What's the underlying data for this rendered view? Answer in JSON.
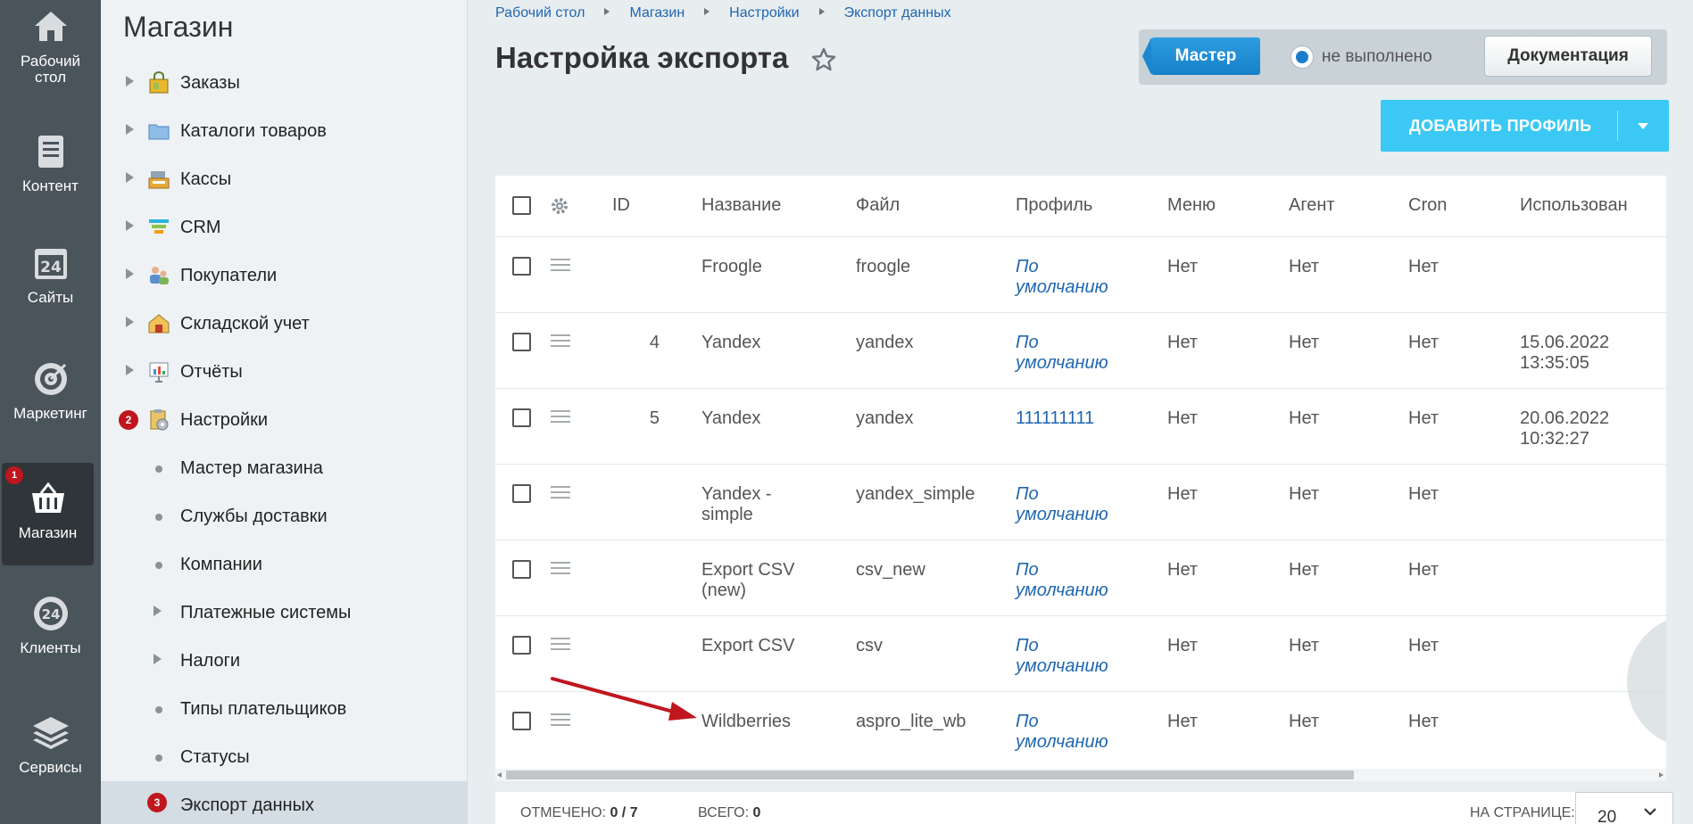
{
  "leftbar": {
    "items": [
      {
        "label": "Рабочий стол",
        "icon": "home-icon"
      },
      {
        "label": "Контент",
        "icon": "document-icon"
      },
      {
        "label": "Сайты",
        "icon": "calendar-24-icon"
      },
      {
        "label": "Маркетинг",
        "icon": "target-icon"
      },
      {
        "label": "Магазин",
        "icon": "basket-icon",
        "badge": "1"
      },
      {
        "label": "Клиенты",
        "icon": "clients-24-icon"
      },
      {
        "label": "Сервисы",
        "icon": "layers-icon"
      }
    ]
  },
  "menu": {
    "title": "Магазин",
    "items": [
      {
        "label": "Заказы"
      },
      {
        "label": "Каталоги товаров"
      },
      {
        "label": "Кассы"
      },
      {
        "label": "CRM"
      },
      {
        "label": "Покупатели"
      },
      {
        "label": "Складской учет"
      },
      {
        "label": "Отчёты"
      },
      {
        "label": "Настройки",
        "badge": "2"
      },
      {
        "label": "Мастер магазина"
      },
      {
        "label": "Службы доставки"
      },
      {
        "label": "Компании"
      },
      {
        "label": "Платежные системы"
      },
      {
        "label": "Налоги"
      },
      {
        "label": "Типы плательщиков"
      },
      {
        "label": "Статусы"
      },
      {
        "label": "Экспорт данных",
        "badge": "3"
      }
    ]
  },
  "breadcrumb": [
    "Рабочий стол",
    "Магазин",
    "Настройки",
    "Экспорт данных"
  ],
  "page_title": "Настройка экспорта",
  "wizard": {
    "button": "Мастер",
    "status": "не выполнено",
    "docs": "Документация"
  },
  "add_profile": "ДОБАВИТЬ ПРОФИЛЬ",
  "table": {
    "headers": [
      "ID",
      "Название",
      "Файл",
      "Профиль",
      "Меню",
      "Агент",
      "Cron",
      "Использован"
    ],
    "rows": [
      {
        "id": "",
        "name": "Froogle",
        "file": "froogle",
        "profile": "По умолчанию",
        "menu": "Нет",
        "agent": "Нет",
        "cron": "Нет",
        "used": ""
      },
      {
        "id": "4",
        "name": "Yandex",
        "file": "yandex",
        "profile": "По умолчанию",
        "menu": "Нет",
        "agent": "Нет",
        "cron": "Нет",
        "used": "15.06.2022 13:35:05"
      },
      {
        "id": "5",
        "name": "Yandex",
        "file": "yandex",
        "profile": "111111111",
        "menu": "Нет",
        "agent": "Нет",
        "cron": "Нет",
        "used": "20.06.2022 10:32:27"
      },
      {
        "id": "",
        "name": "Yandex - simple",
        "file": "yandex_simple",
        "profile": "По умолчанию",
        "menu": "Нет",
        "agent": "Нет",
        "cron": "Нет",
        "used": ""
      },
      {
        "id": "",
        "name": "Export CSV (new)",
        "file": "csv_new",
        "profile": "По умолчанию",
        "menu": "Нет",
        "agent": "Нет",
        "cron": "Нет",
        "used": ""
      },
      {
        "id": "",
        "name": "Export CSV",
        "file": "csv",
        "profile": "По умолчанию",
        "menu": "Нет",
        "agent": "Нет",
        "cron": "Нет",
        "used": ""
      },
      {
        "id": "",
        "name": "Wildberries",
        "file": "aspro_lite_wb",
        "profile": "По умолчанию",
        "menu": "Нет",
        "agent": "Нет",
        "cron": "Нет",
        "used": ""
      }
    ]
  },
  "footer": {
    "checked_label": "ОТМЕЧЕНО:",
    "checked_value": "0 / 7",
    "total_label": "ВСЕГО:",
    "total_value": "0",
    "per_page_label": "НА СТРАНИЦЕ:",
    "per_page_value": "20"
  },
  "colors": {
    "accent": "#3bc8f5",
    "link": "#2067b0",
    "badge": "#c0161e",
    "arrow": "#c0161e"
  }
}
